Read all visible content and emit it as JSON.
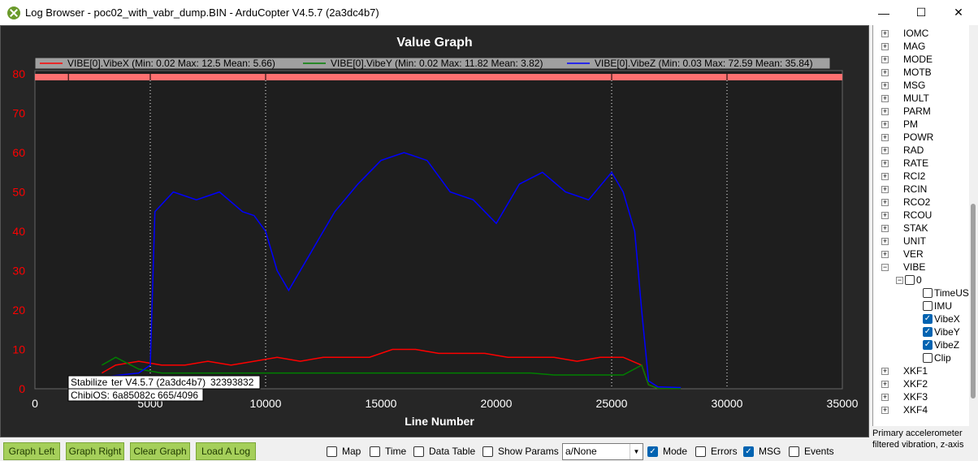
{
  "window": {
    "title": "Log Browser - poc02_with_vabr_dump.BIN - ArduCopter V4.5.7 (2a3dc4b7)",
    "minimize_glyph": "—",
    "maximize_glyph": "☐",
    "close_glyph": "✕"
  },
  "graph": {
    "title": "Value Graph",
    "xlabel": "Line Number",
    "legend": [
      {
        "label": "VIBE[0].VibeX  (Min: 0.02 Max: 12.5 Mean: 5.66)",
        "color": "#ff0000"
      },
      {
        "label": "VIBE[0].VibeY  (Min: 0.02 Max: 11.82 Mean: 3.82)",
        "color": "#008000"
      },
      {
        "label": "VIBE[0].VibeZ  (Min: 0.03 Max: 72.59 Mean: 35.84)",
        "color": "#0000ff"
      }
    ],
    "tooltip_line1": "Stabilize",
    "tooltip_line1b": "ter V4.5.7 (2a3dc4b7)",
    "tooltip_line1c": "32393832",
    "tooltip_line2a": "ChibiOS: 6a85082c",
    "tooltip_line2b": "665/4096"
  },
  "chart_data": {
    "type": "line",
    "title": "Value Graph",
    "xlabel": "Line Number",
    "ylabel": "",
    "xlim": [
      0,
      35000
    ],
    "ylim": [
      0,
      80
    ],
    "x_ticks": [
      "0",
      "5000",
      "10000",
      "15000",
      "20000",
      "25000",
      "30000",
      "35000"
    ],
    "y_ticks": [
      "0",
      "10",
      "20",
      "30",
      "40",
      "50",
      "60",
      "70",
      "80"
    ],
    "mode_change_lines": [
      5000,
      10000,
      25000,
      30000
    ],
    "mode_markers": [
      1450,
      5000,
      10000,
      25000,
      30000
    ],
    "series": [
      {
        "name": "VIBE[0].VibeX",
        "color": "#ff0000",
        "min": 0.02,
        "max": 12.5,
        "mean": 5.66,
        "x": [
          2900,
          3500,
          4500,
          5500,
          6500,
          7500,
          8500,
          9500,
          10500,
          11500,
          12500,
          13500,
          14500,
          15500,
          16500,
          17500,
          18500,
          19500,
          20500,
          21500,
          22500,
          23500,
          24500,
          25500,
          26300,
          26600,
          27000,
          28000
        ],
        "y": [
          4,
          6,
          7,
          6,
          6,
          7,
          6,
          7,
          8,
          7,
          8,
          8,
          8,
          10,
          10,
          9,
          9,
          9,
          8,
          8,
          8,
          7,
          8,
          8,
          6,
          1,
          0.1,
          0.05
        ]
      },
      {
        "name": "VIBE[0].VibeY",
        "color": "#008000",
        "min": 0.02,
        "max": 11.82,
        "mean": 3.82,
        "x": [
          2900,
          3500,
          4500,
          5500,
          6500,
          7500,
          8500,
          9500,
          10500,
          11500,
          12500,
          13500,
          14500,
          15500,
          16500,
          17500,
          18500,
          19500,
          20500,
          21500,
          22500,
          23500,
          24500,
          25500,
          26300,
          26600,
          27000,
          28000
        ],
        "y": [
          6,
          8,
          5,
          4,
          4,
          4,
          4,
          4,
          4,
          4,
          4,
          4,
          4,
          4,
          4,
          4,
          4,
          4,
          4,
          4,
          3.5,
          3.5,
          3.5,
          3.5,
          6,
          1,
          0.1,
          0.05
        ]
      },
      {
        "name": "VIBE[0].VibeZ",
        "color": "#0000ff",
        "min": 0.03,
        "max": 72.59,
        "mean": 35.84,
        "x": [
          2900,
          4500,
          5000,
          5200,
          6000,
          7000,
          8000,
          9000,
          9500,
          10000,
          10500,
          11000,
          12000,
          13000,
          14000,
          15000,
          16000,
          17000,
          18000,
          19000,
          20000,
          21000,
          22000,
          23000,
          24000,
          25000,
          25500,
          26000,
          26300,
          26600,
          27000,
          28000
        ],
        "y": [
          3,
          4,
          6,
          45,
          50,
          48,
          50,
          45,
          44,
          40,
          30,
          25,
          35,
          45,
          52,
          58,
          60,
          58,
          50,
          48,
          42,
          52,
          55,
          50,
          48,
          55,
          50,
          40,
          20,
          2,
          0.5,
          0.3
        ]
      }
    ]
  },
  "tree": {
    "items": [
      {
        "label": "IOMC",
        "type": "node"
      },
      {
        "label": "MAG",
        "type": "node"
      },
      {
        "label": "MODE",
        "type": "node"
      },
      {
        "label": "MOTB",
        "type": "node"
      },
      {
        "label": "MSG",
        "type": "node"
      },
      {
        "label": "MULT",
        "type": "node"
      },
      {
        "label": "PARM",
        "type": "node"
      },
      {
        "label": "PM",
        "type": "node"
      },
      {
        "label": "POWR",
        "type": "node"
      },
      {
        "label": "RAD",
        "type": "node"
      },
      {
        "label": "RATE",
        "type": "node"
      },
      {
        "label": "RCI2",
        "type": "node"
      },
      {
        "label": "RCIN",
        "type": "node"
      },
      {
        "label": "RCO2",
        "type": "node"
      },
      {
        "label": "RCOU",
        "type": "node"
      },
      {
        "label": "STAK",
        "type": "node"
      },
      {
        "label": "UNIT",
        "type": "node"
      },
      {
        "label": "VER",
        "type": "node"
      },
      {
        "label": "VIBE",
        "type": "expanded"
      },
      {
        "label": "0",
        "type": "instance"
      },
      {
        "label": "TimeUS",
        "type": "field",
        "checked": false
      },
      {
        "label": "IMU",
        "type": "field",
        "checked": false
      },
      {
        "label": "VibeX",
        "type": "field",
        "checked": true
      },
      {
        "label": "VibeY",
        "type": "field",
        "checked": true
      },
      {
        "label": "VibeZ",
        "type": "field",
        "checked": true
      },
      {
        "label": "Clip",
        "type": "field",
        "checked": false
      },
      {
        "label": "XKF1",
        "type": "node"
      },
      {
        "label": "XKF2",
        "type": "node"
      },
      {
        "label": "XKF3",
        "type": "node"
      },
      {
        "label": "XKF4",
        "type": "node"
      }
    ],
    "description": "Primary accelerometer filtered vibration, z-axis"
  },
  "toolbar": {
    "graph_left": "Graph Left",
    "graph_right": "Graph Right",
    "clear_graph": "Clear Graph",
    "load_log": "Load A Log",
    "map": "Map",
    "time": "Time",
    "data_table": "Data Table",
    "show_params": "Show Params",
    "combo_value": "a/None",
    "mode": "Mode",
    "errors": "Errors",
    "msg": "MSG",
    "events": "Events"
  },
  "toolbar_states": {
    "map": false,
    "time": false,
    "data_table": false,
    "show_params": false,
    "mode": true,
    "errors": false,
    "msg": true,
    "events": false
  }
}
